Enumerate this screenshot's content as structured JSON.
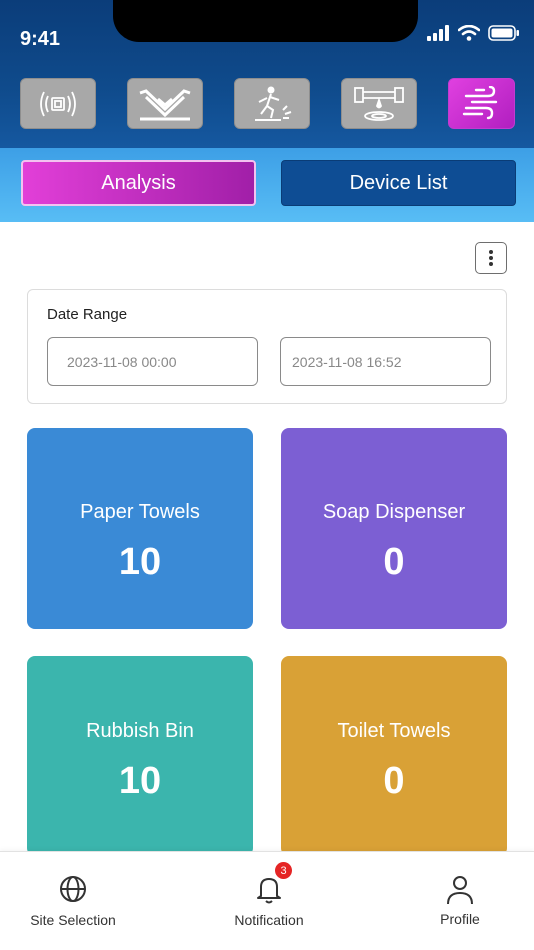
{
  "status_bar": {
    "time": "9:41"
  },
  "categories": [
    {
      "icon": "sensor-icon",
      "active": false
    },
    {
      "icon": "paper-towel-icon",
      "active": false
    },
    {
      "icon": "wet-floor-icon",
      "active": false
    },
    {
      "icon": "leak-detector-icon",
      "active": false
    },
    {
      "icon": "air-quality-icon",
      "active": true
    }
  ],
  "tabs": {
    "analysis": "Analysis",
    "device_list": "Device List"
  },
  "date_range": {
    "label": "Date Range",
    "start": "2023-11-08 00:00",
    "end": "2023-11-08 16:52"
  },
  "stats": [
    {
      "label": "Paper Towels",
      "value": "10",
      "color": "#3a8ad6"
    },
    {
      "label": "Soap Dispenser",
      "value": "0",
      "color": "#7c5fd3"
    },
    {
      "label": "Rubbish Bin",
      "value": "10",
      "color": "#3bb5ad"
    },
    {
      "label": "Toilet Towels",
      "value": "0",
      "color": "#d9a136"
    }
  ],
  "bottom_nav": {
    "site_selection": "Site Selection",
    "notification": "Notification",
    "notification_count": "3",
    "profile": "Profile"
  },
  "colors": {
    "header": "#0f4b8c",
    "accent": "#d136d0",
    "tab_active": "#c02cc4",
    "tab_inactive": "#0e4d94"
  }
}
